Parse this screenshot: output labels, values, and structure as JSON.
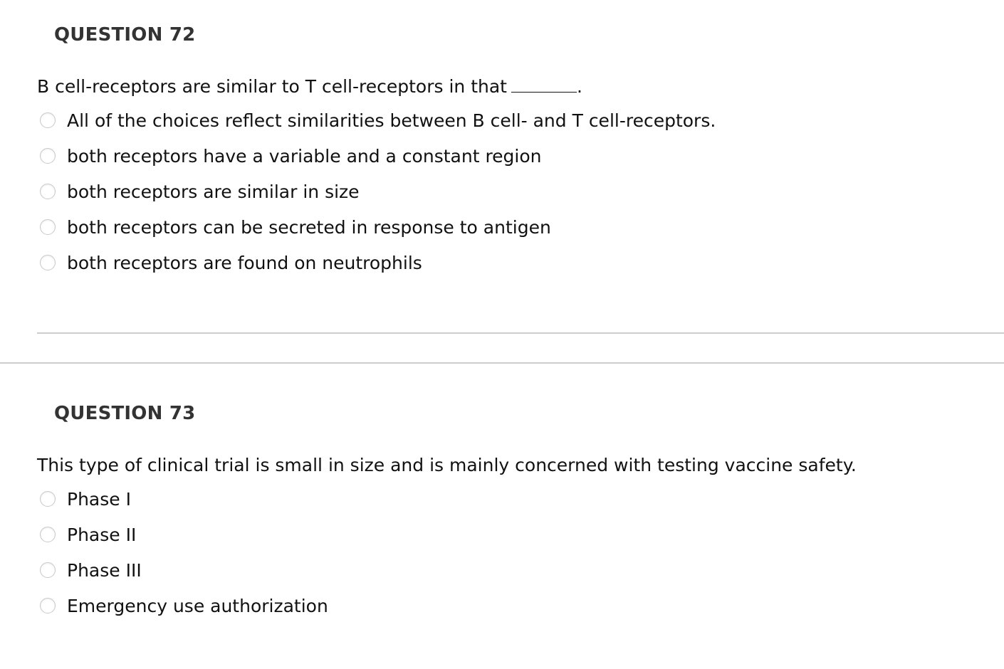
{
  "questions": [
    {
      "title": "QUESTION 72",
      "prompt": "B cell-receptors are similar to T cell-receptors in that",
      "prompt_suffix": ".",
      "options": [
        {
          "label": "All of the choices reflect similarities between B cell- and T cell-receptors.",
          "selected": false
        },
        {
          "label": "both receptors have a variable and a constant region",
          "selected": false
        },
        {
          "label": "both receptors are similar in size",
          "selected": false
        },
        {
          "label": "both receptors can be secreted in response to antigen",
          "selected": false
        },
        {
          "label": "both receptors are found on neutrophils",
          "selected": false
        }
      ]
    },
    {
      "title": "QUESTION 73",
      "prompt": "This type of clinical trial is small in size and is mainly concerned with testing vaccine safety.",
      "options": [
        {
          "label": "Phase I",
          "selected": false
        },
        {
          "label": "Phase II",
          "selected": false
        },
        {
          "label": "Phase III",
          "selected": false
        },
        {
          "label": "Emergency use authorization",
          "selected": false
        }
      ]
    }
  ]
}
